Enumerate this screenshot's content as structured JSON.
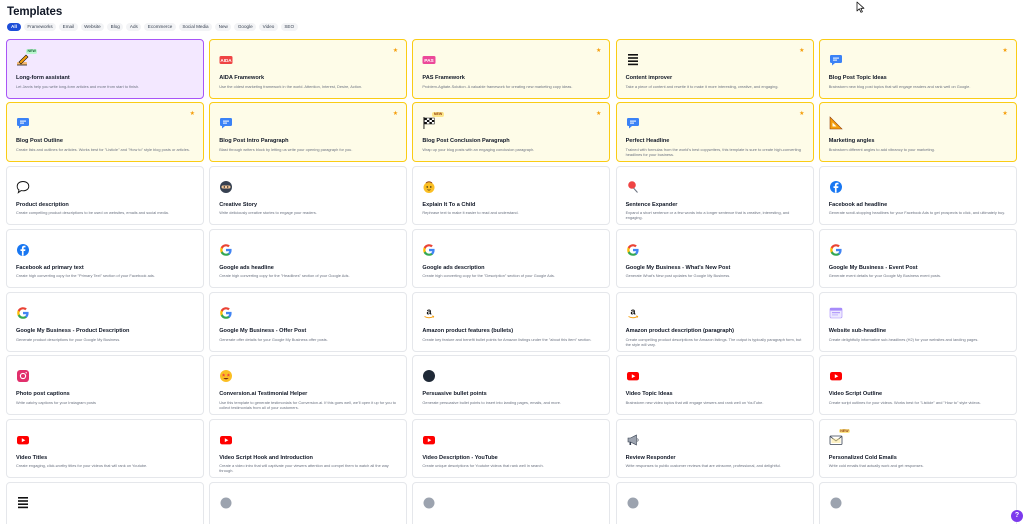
{
  "page": {
    "title": "Templates"
  },
  "filters": [
    "All",
    "Frameworks",
    "Email",
    "Website",
    "Blog",
    "Ads",
    "Ecommerce",
    "Social Media",
    "New",
    "Google",
    "Video",
    "SEO"
  ],
  "active_filter": "All",
  "help_label": "?",
  "colors": {
    "accent": "#1d4ed8",
    "premium_bg": "#fefce8",
    "premium_border": "#facc15",
    "selected_bg": "#f3e8ff",
    "selected_border": "#a855f7",
    "star": "#f59e0b"
  },
  "templates": [
    {
      "title": "Long-form assistant",
      "desc": "Let Jarvis help you write long-form articles and more from start to finish.",
      "icon": "pencil-hand-icon",
      "variant": "selected",
      "badge": "NEW"
    },
    {
      "title": "AIDA Framework",
      "desc": "Use the oldest marketing framework in the world. Attention, Interest, Desire, Action.",
      "icon": "aida-icon",
      "variant": "premium",
      "star": true
    },
    {
      "title": "PAS Framework",
      "desc": "Problem-Agitate-Solution. A valuable framework for creating new marketing copy ideas.",
      "icon": "pas-icon",
      "variant": "premium",
      "star": true
    },
    {
      "title": "Content improver",
      "desc": "Take a piece of content and rewrite it to make it more interesting, creative, and engaging.",
      "icon": "lines-icon",
      "variant": "premium",
      "star": true
    },
    {
      "title": "Blog Post Topic Ideas",
      "desc": "Brainstorm new blog post topics that will engage readers and rank well on Google.",
      "icon": "chat-bubble-icon",
      "variant": "premium",
      "star": true
    },
    {
      "title": "Blog Post Outline",
      "desc": "Create lists and outlines for articles. Works best for \"Listicle\" and \"How to\" style blog posts or articles.",
      "icon": "chat-bubble-icon",
      "variant": "premium",
      "star": true
    },
    {
      "title": "Blog Post Intro Paragraph",
      "desc": "Blast through writers block by letting us write your opening paragraph for you.",
      "icon": "chat-bubble-icon",
      "variant": "premium",
      "star": true
    },
    {
      "title": "Blog Post Conclusion Paragraph",
      "desc": "Wrap up your blog posts with an engaging conclusion paragraph.",
      "icon": "checkered-flag-icon",
      "variant": "premium",
      "star": true,
      "badge": "NEW"
    },
    {
      "title": "Perfect Headline",
      "desc": "Trained with formulas from the world's best copywriters, this template is sure to create high-converting headlines for your business.",
      "icon": "chat-bubble-icon",
      "variant": "premium",
      "star": true
    },
    {
      "title": "Marketing angles",
      "desc": "Brainstorm different angles to add vibrancy to your marketing.",
      "icon": "triangle-ruler-icon",
      "variant": "premium",
      "star": true
    },
    {
      "title": "Product description",
      "desc": "Create compelling product descriptions to be used on websites, emails and social media.",
      "icon": "speech-bubble-icon"
    },
    {
      "title": "Creative Story",
      "desc": "Write deliciously creative stories to engage your readers.",
      "icon": "ninja-icon"
    },
    {
      "title": "Explain It To a Child",
      "desc": "Rephrase text to make it easier to read and understand.",
      "icon": "child-face-icon"
    },
    {
      "title": "Sentence Expander",
      "desc": "Expand a short sentence or a few words into a longer sentence that is creative, interesting, and engaging.",
      "icon": "pushpin-icon"
    },
    {
      "title": "Facebook ad headline",
      "desc": "Generate scroll-stopping headlines for your Facebook Ads to get prospects to click, and ultimately buy.",
      "icon": "facebook-icon"
    },
    {
      "title": "Facebook ad primary text",
      "desc": "Create high converting copy for the \"Primary Text\" section of your Facebook ads.",
      "icon": "facebook-icon"
    },
    {
      "title": "Google ads headline",
      "desc": "Create high converting copy for the \"Headlines\" section of your Google Ads.",
      "icon": "google-icon"
    },
    {
      "title": "Google ads description",
      "desc": "Create high converting copy for the \"Description\" section of your Google Ads.",
      "icon": "google-icon"
    },
    {
      "title": "Google My Business - What's New Post",
      "desc": "Generate What's New post updates for Google My Business.",
      "icon": "google-icon"
    },
    {
      "title": "Google My Business - Event Post",
      "desc": "Generate event details for your Google My Business event posts.",
      "icon": "google-icon"
    },
    {
      "title": "Google My Business - Product Description",
      "desc": "Generate product descriptions for your Google My Business.",
      "icon": "google-icon"
    },
    {
      "title": "Google My Business - Offer Post",
      "desc": "Generate offer details for your Google My Business offer posts.",
      "icon": "google-icon"
    },
    {
      "title": "Amazon product features (bullets)",
      "desc": "Create key feature and benefit bullet points for Amazon listings under the \"about this item\" section.",
      "icon": "amazon-icon"
    },
    {
      "title": "Amazon product description (paragraph)",
      "desc": "Create compelling product descriptions for Amazon listings. The output is typically paragraph form, but the style will vary.",
      "icon": "amazon-icon"
    },
    {
      "title": "Website sub-headline",
      "desc": "Create delightfully informative sub-headlines (H2) for your websites and landing pages.",
      "icon": "browser-icon"
    },
    {
      "title": "Photo post captions",
      "desc": "Write catchy captions for your Instagram posts",
      "icon": "instagram-icon"
    },
    {
      "title": "Conversion.ai Testimonial Helper",
      "desc": "Use this template to generate testimonials for Conversion.ai. If this goes well, we'll open it up for you to collect testimonials from all of your customers.",
      "icon": "star-eyes-icon"
    },
    {
      "title": "Persuasive bullet points",
      "desc": "Generate persuasive bullet points to insert into landing pages, emails, and more.",
      "icon": "black-circle-icon"
    },
    {
      "title": "Video Topic Ideas",
      "desc": "Brainstorm new video topics that will engage viewers and rank well on YouTube.",
      "icon": "youtube-icon"
    },
    {
      "title": "Video Script Outline",
      "desc": "Create script outlines for your videos. Works best for \"Listicle\" and \"How to\" style videos.",
      "icon": "youtube-icon"
    },
    {
      "title": "Video Titles",
      "desc": "Create engaging, click-worthy titles for your videos that will rank on Youtube.",
      "icon": "youtube-icon"
    },
    {
      "title": "Video Script Hook and Introduction",
      "desc": "Create a video intro that will captivate your viewers attention and compel them to watch all the way through.",
      "icon": "youtube-icon"
    },
    {
      "title": "Video Description - YouTube",
      "desc": "Create unique descriptions for Youtube videos that rank well in search.",
      "icon": "youtube-icon"
    },
    {
      "title": "Review Responder",
      "desc": "Write responses to public customer reviews that are winsome, professional, and delightful.",
      "icon": "megaphone-icon"
    },
    {
      "title": "Personalized Cold Emails",
      "desc": "Write cold emails that actually work and get responses.",
      "icon": "envelope-icon",
      "badge": "NEW"
    },
    {
      "title": "",
      "desc": "",
      "icon": "lines-icon"
    },
    {
      "title": "",
      "desc": "",
      "icon": "generic-circle-icon"
    },
    {
      "title": "",
      "desc": "",
      "icon": "generic-circle-icon"
    },
    {
      "title": "",
      "desc": "",
      "icon": "generic-circle-icon"
    },
    {
      "title": "",
      "desc": "",
      "icon": "generic-circle-icon"
    }
  ]
}
